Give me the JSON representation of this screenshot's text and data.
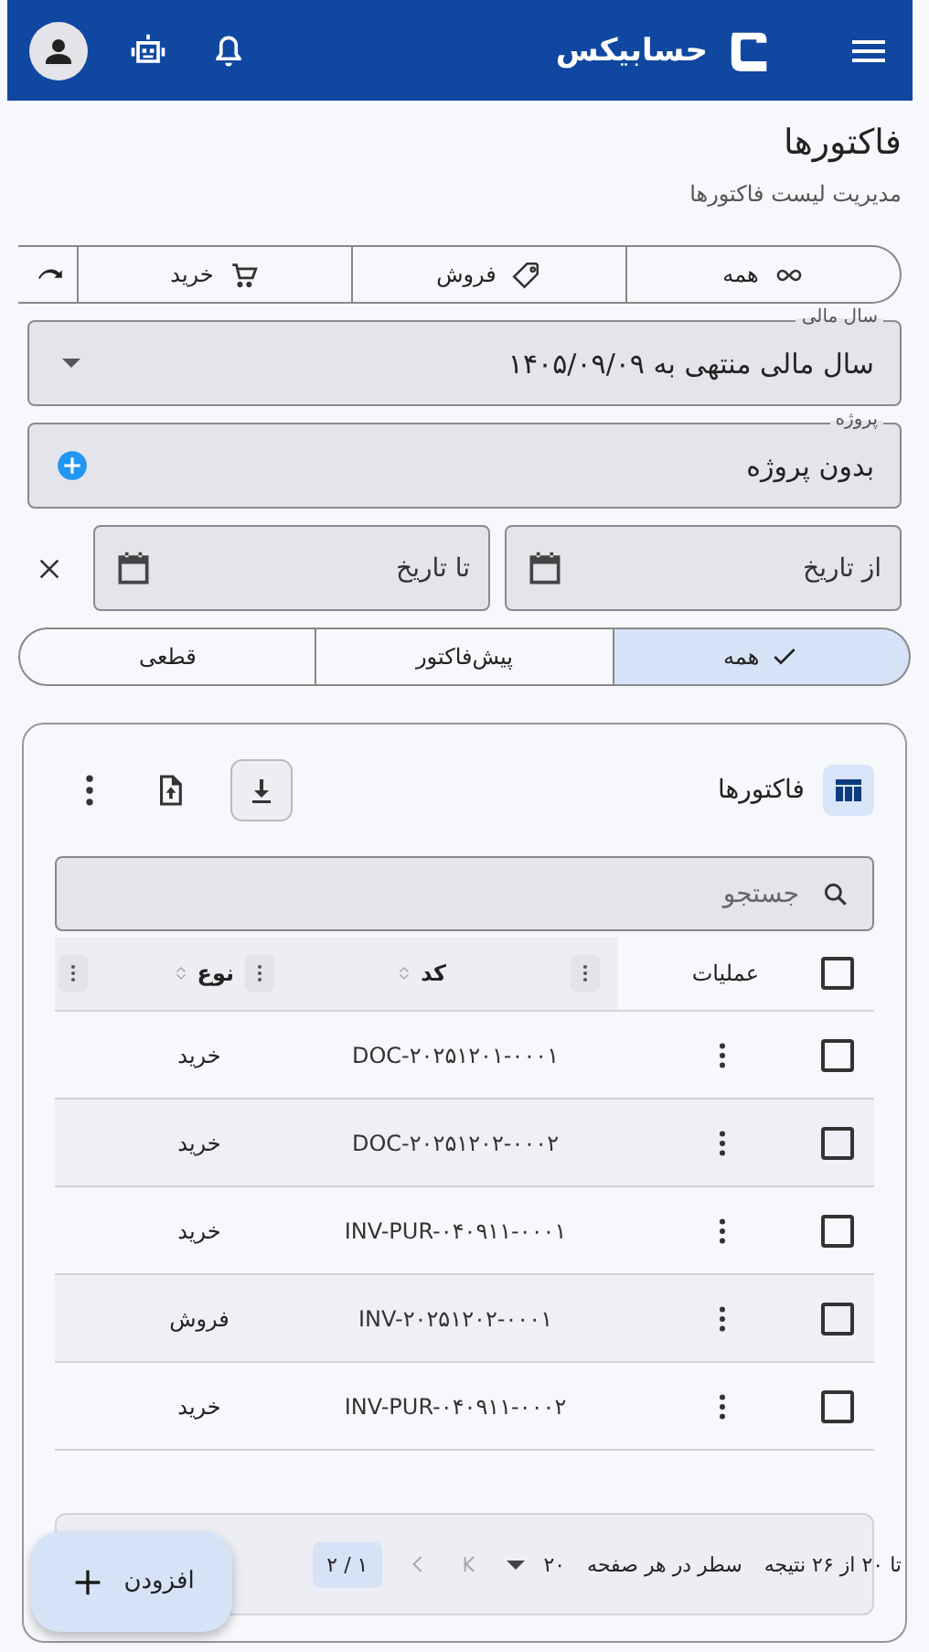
{
  "app_bar": {
    "brand": "حسابیکس"
  },
  "page": {
    "title": "فاکتورها",
    "subtitle": "مدیریت لیست فاکتورها"
  },
  "type_filter": [
    {
      "kind": "all",
      "label": "همه",
      "selected": false
    },
    {
      "kind": "sale",
      "label": "فروش",
      "selected": false
    },
    {
      "kind": "purchase",
      "label": "خرید",
      "selected": false
    },
    {
      "kind": "return",
      "selected": false
    }
  ],
  "fiscal_year": {
    "label": "سال مالی",
    "value": "سال مالی منتهی به ۱۴۰۵/۰۹/۰۹"
  },
  "project": {
    "label": "پروژه",
    "value": "بدون پروژه"
  },
  "date_from": {
    "placeholder": "از تاریخ"
  },
  "date_to": {
    "placeholder": "تا تاریخ"
  },
  "status_filter": [
    {
      "label": "همه",
      "selected": true
    },
    {
      "label": "پیش‌فاکتور",
      "selected": false
    },
    {
      "label": "قطعی",
      "selected": false
    }
  ],
  "table": {
    "title": "فاکتورها",
    "search": {
      "placeholder": "جستجو"
    },
    "select_all": {
      "checked": false
    },
    "columns": [
      {
        "label": "عملیات",
        "sortable": false
      },
      {
        "label": "کد",
        "sortable": true
      },
      {
        "label": "نوع",
        "sortable": true
      }
    ],
    "rows": [
      {
        "code": "DOC-۲۰۲۵۱۲۰۱-۰۰۰۱",
        "type": "خرید",
        "checked": false
      },
      {
        "code": "DOC-۲۰۲۵۱۲۰۲-۰۰۰۲",
        "type": "خرید",
        "checked": false
      },
      {
        "code": "INV-PUR-۰۴۰۹۱۱-۰۰۰۱",
        "type": "خرید",
        "checked": false
      },
      {
        "code": "INV-۲۰۲۵۱۲۰۲-۰۰۰۱",
        "type": "فروش",
        "checked": false
      },
      {
        "code": "INV-PUR-۰۴۰۹۱۱-۰۰۰۲",
        "type": "خرید",
        "checked": false
      }
    ],
    "pagination": {
      "range": "تا ۲۰ از ۲۶ نتیجه",
      "rows_per_page_label": "سطر در هر صفحه",
      "rows_per_page": "۲۰",
      "page": "۱ / ۲"
    }
  },
  "fab": {
    "label": "افزودن"
  }
}
